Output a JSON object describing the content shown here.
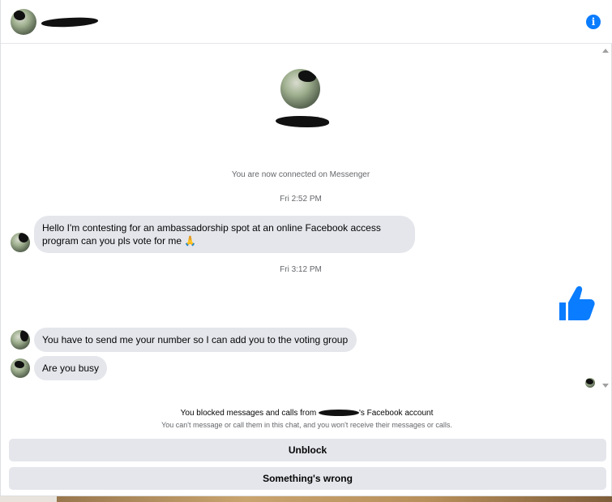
{
  "header": {
    "info_icon": "i"
  },
  "conversation": {
    "connected_text": "You are now connected on Messenger",
    "timestamps": [
      "Fri 2:52 PM",
      "Fri 3:12 PM"
    ],
    "messages": [
      {
        "sender": "contact",
        "text": "Hello I'm contesting for an ambassadorship spot at an online Facebook access program can you pls vote for me 🙏"
      },
      {
        "sender": "me",
        "type": "like",
        "icon": "thumbs-up-icon"
      },
      {
        "sender": "contact",
        "text": "You have to send me your number so I can add you to the voting group"
      },
      {
        "sender": "contact",
        "text": "Are you busy"
      }
    ]
  },
  "footer": {
    "blocked_prefix": "You blocked messages and calls from ",
    "blocked_suffix": "'s Facebook account",
    "blocked_sub": "You can't message or call them in this chat, and you won't receive their messages or calls.",
    "unblock_label": "Unblock",
    "wrong_label": "Something's wrong"
  },
  "colors": {
    "accent": "#0a7cff",
    "bubble": "#e4e6eb",
    "meta_text": "#65676b"
  }
}
